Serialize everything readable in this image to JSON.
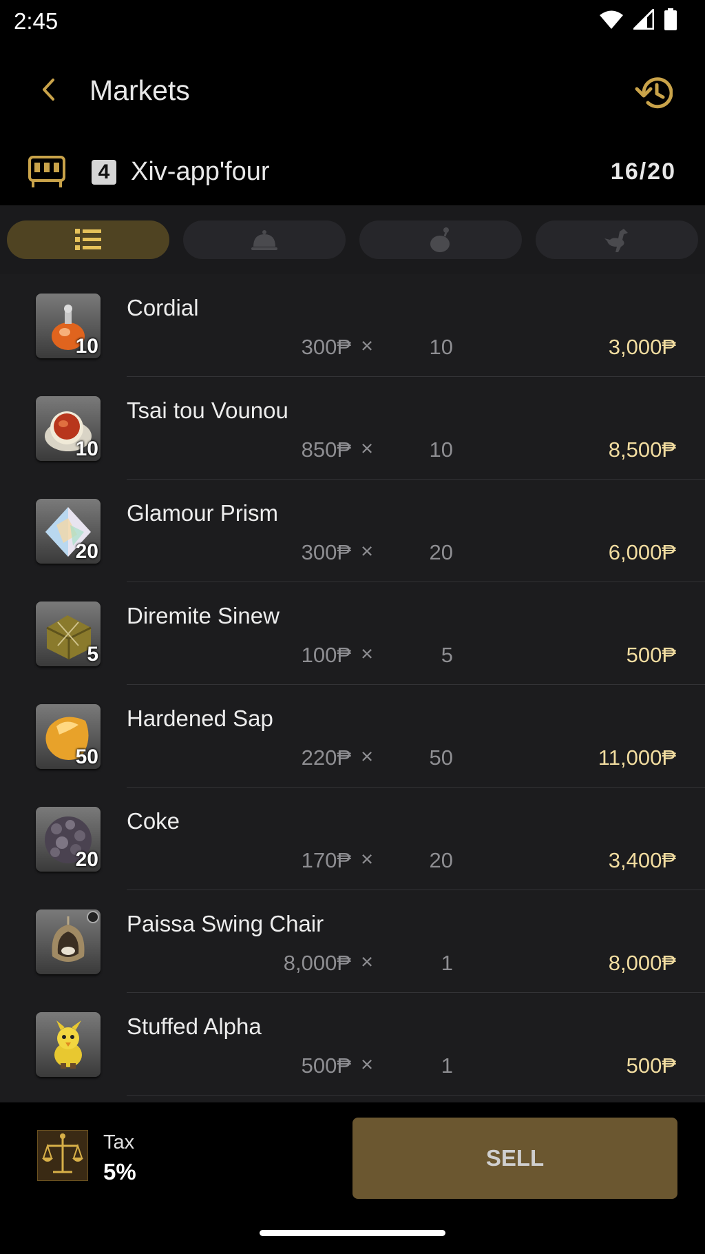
{
  "status": {
    "time": "2:45"
  },
  "appbar": {
    "title": "Markets"
  },
  "retainer": {
    "number": "4",
    "name": "Xiv-app'four",
    "count": "16/20"
  },
  "colors": {
    "accent": "#c9a34a",
    "total": "#f1dca0",
    "active_tab": "#4f4322",
    "sell_button": "#6b5730"
  },
  "tabs": [
    {
      "icon": "list-icon",
      "active": true
    },
    {
      "icon": "service-bell-icon",
      "active": false
    },
    {
      "icon": "moogle-icon",
      "active": false
    },
    {
      "icon": "chocobo-icon",
      "active": false
    }
  ],
  "items": [
    {
      "name": "Cordial",
      "qty_badge": "10",
      "price": "300₱",
      "multiplier": "×",
      "qty": "10",
      "total": "3,000₱",
      "icon": "cordial-icon"
    },
    {
      "name": "Tsai tou Vounou",
      "qty_badge": "10",
      "price": "850₱",
      "multiplier": "×",
      "qty": "10",
      "total": "8,500₱",
      "icon": "tea-cup-icon"
    },
    {
      "name": "Glamour Prism",
      "qty_badge": "20",
      "price": "300₱",
      "multiplier": "×",
      "qty": "20",
      "total": "6,000₱",
      "icon": "prism-icon"
    },
    {
      "name": "Diremite Sinew",
      "qty_badge": "5",
      "price": "100₱",
      "multiplier": "×",
      "qty": "5",
      "total": "500₱",
      "icon": "sinew-bundle-icon"
    },
    {
      "name": "Hardened Sap",
      "qty_badge": "50",
      "price": "220₱",
      "multiplier": "×",
      "qty": "50",
      "total": "11,000₱",
      "icon": "sap-icon"
    },
    {
      "name": "Coke",
      "qty_badge": "20",
      "price": "170₱",
      "multiplier": "×",
      "qty": "20",
      "total": "3,400₱",
      "icon": "coke-icon"
    },
    {
      "name": "Paissa Swing Chair",
      "qty_badge": "",
      "price": "8,000₱",
      "multiplier": "×",
      "qty": "1",
      "total": "8,000₱",
      "icon": "swing-chair-icon"
    },
    {
      "name": "Stuffed Alpha",
      "qty_badge": "",
      "price": "500₱",
      "multiplier": "×",
      "qty": "1",
      "total": "500₱",
      "icon": "stuffed-alpha-icon"
    }
  ],
  "footer": {
    "tax_label": "Tax",
    "tax_value": "5%",
    "sell_label": "SELL"
  }
}
